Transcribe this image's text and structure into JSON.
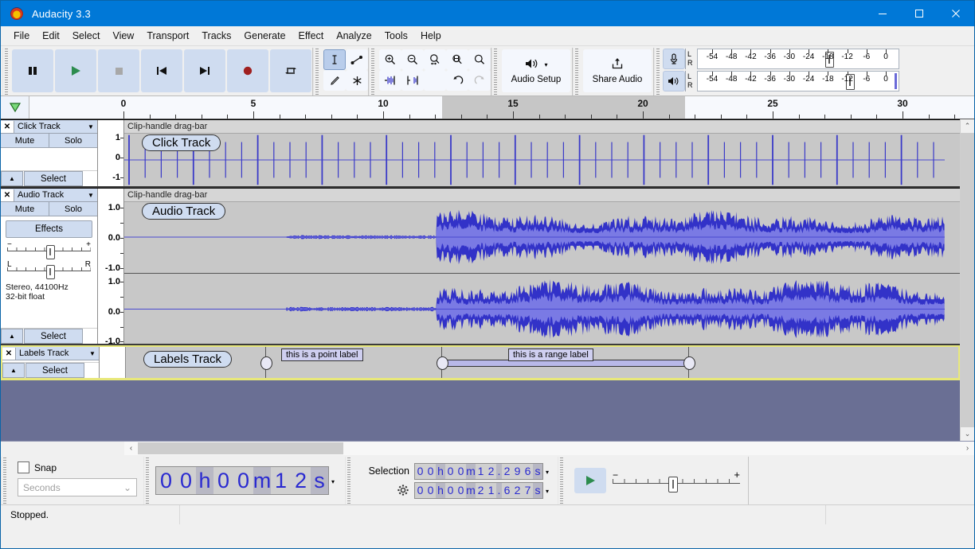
{
  "window": {
    "title": "Audacity 3.3",
    "icon": "audacity-logo-icon",
    "minimize": "minimize-icon",
    "maximize": "maximize-icon",
    "close": "close-icon"
  },
  "menubar": {
    "items": [
      "File",
      "Edit",
      "Select",
      "View",
      "Transport",
      "Tracks",
      "Generate",
      "Effect",
      "Analyze",
      "Tools",
      "Help"
    ]
  },
  "toolbars": {
    "transport": [
      {
        "name": "pause-button",
        "icon": "pause-icon"
      },
      {
        "name": "play-button",
        "icon": "play-icon"
      },
      {
        "name": "stop-button",
        "icon": "stop-icon"
      },
      {
        "name": "skip-to-start-button",
        "icon": "skip-start-icon"
      },
      {
        "name": "skip-to-end-button",
        "icon": "skip-end-icon"
      },
      {
        "name": "record-button",
        "icon": "record-icon"
      },
      {
        "name": "loop-button",
        "icon": "loop-icon"
      }
    ],
    "tools": [
      {
        "name": "selection-tool",
        "icon": "i-beam-icon",
        "selected": true
      },
      {
        "name": "envelope-tool",
        "icon": "envelope-icon",
        "selected": false
      },
      {
        "name": "draw-tool",
        "icon": "pencil-icon",
        "selected": false
      },
      {
        "name": "multi-tool",
        "icon": "asterisk-icon",
        "selected": false
      }
    ],
    "edit": [
      {
        "name": "zoom-in-button",
        "icon": "zoom-in-icon"
      },
      {
        "name": "zoom-out-button",
        "icon": "zoom-out-icon"
      },
      {
        "name": "fit-selection-button",
        "icon": "fit-selection-icon"
      },
      {
        "name": "fit-project-button",
        "icon": "fit-project-icon"
      },
      {
        "name": "zoom-toggle-button",
        "icon": "zoom-toggle-icon"
      },
      {
        "name": "trim-audio-button",
        "icon": "trim-icon"
      },
      {
        "name": "silence-audio-button",
        "icon": "silence-icon"
      },
      {
        "name": "undo-button",
        "icon": "undo-icon"
      },
      {
        "name": "redo-button",
        "icon": "redo-icon"
      }
    ],
    "audio_setup": {
      "label": "Audio Setup",
      "icon": "speaker-icon",
      "caret": "▾"
    },
    "share_audio": {
      "label": "Share Audio",
      "icon": "upload-icon"
    },
    "meters": {
      "record_icon": "microphone-icon",
      "play_icon": "speaker-icon",
      "channels": [
        "L",
        "R"
      ],
      "scale": [
        "-54",
        "-48",
        "-42",
        "-36",
        "-30",
        "-24",
        "-18",
        "-12",
        "-6",
        "0"
      ]
    }
  },
  "timeline": {
    "pinned_play_head": "play-head-triangle-icon",
    "labels": [
      "0",
      "5",
      "10",
      "15",
      "20",
      "25",
      "30"
    ],
    "selection_start_label": "15",
    "selection_end_label": "20"
  },
  "tracks": [
    {
      "name": "Click Track",
      "close": "✕",
      "caret": "▼",
      "mute": "Mute",
      "solo": "Solo",
      "select": "Select",
      "collapse": "▲",
      "clip_head": "Clip-handle drag-bar",
      "clip_name": "Click Track",
      "ruler": [
        "1",
        "0",
        "-1"
      ]
    },
    {
      "name": "Audio Track",
      "close": "✕",
      "caret": "▼",
      "mute": "Mute",
      "solo": "Solo",
      "effects": "Effects",
      "gain_min": "−",
      "gain_max": "+",
      "pan_left": "L",
      "pan_right": "R",
      "info_line1": "Stereo, 44100Hz",
      "info_line2": "32-bit float",
      "select": "Select",
      "collapse": "▲",
      "clip_head": "Clip-handle drag-bar",
      "clip_name": "Audio Track",
      "ruler": [
        "1.0",
        "0.0",
        "-1.0"
      ]
    },
    {
      "name": "Labels Track",
      "close": "✕",
      "caret": "▼",
      "select": "Select",
      "collapse": "▲",
      "clip_name": "Labels Track",
      "labels": [
        {
          "text": "this is a point label",
          "type": "point"
        },
        {
          "text": "this is a range label",
          "type": "range"
        }
      ]
    }
  ],
  "scrollbars": {
    "h_left": "‹",
    "h_right": "›",
    "v_up": "⌃",
    "v_down": "⌄"
  },
  "bottom": {
    "snap_label": "Snap",
    "snap_checked": false,
    "snap_unit": "Seconds",
    "audio_position": {
      "h": "00",
      "h_unit": "h",
      "m": "00",
      "m_unit": "m",
      "s": "12",
      "s_unit": "s"
    },
    "selection_label": "Selection",
    "selection_settings_icon": "gear-icon",
    "selection_start": "00h00m12.296s",
    "selection_end": "00h00m21.627s",
    "play_at_speed": {
      "icon": "play-icon",
      "minus": "−",
      "plus": "+"
    }
  },
  "status": {
    "message": "Stopped."
  },
  "colors": {
    "title_bar": "#0078d7",
    "toolbar_button": "#cfdcf0",
    "waveform": "#3232c8",
    "waveform_rms": "#7272e0",
    "track_background": "#c8c8c8",
    "focus_border": "#e8e87a",
    "digit_text": "#2a2ad0",
    "record": "#a02020",
    "play": "#2c8c4e"
  }
}
